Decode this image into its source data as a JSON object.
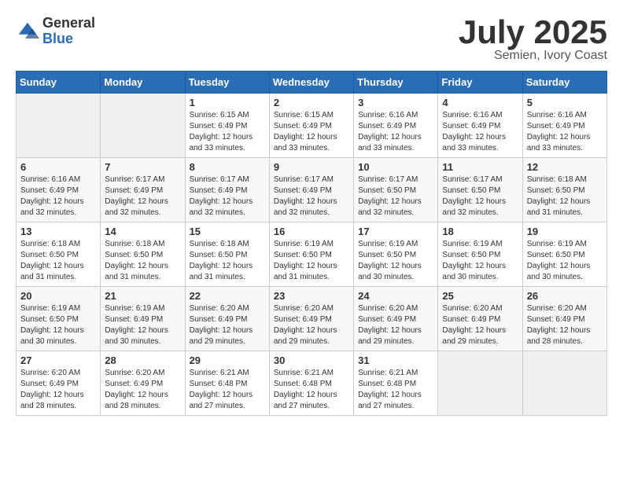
{
  "logo": {
    "general": "General",
    "blue": "Blue"
  },
  "header": {
    "month": "July 2025",
    "location": "Semien, Ivory Coast"
  },
  "weekdays": [
    "Sunday",
    "Monday",
    "Tuesday",
    "Wednesday",
    "Thursday",
    "Friday",
    "Saturday"
  ],
  "weeks": [
    [
      {
        "day": "",
        "sunrise": "",
        "sunset": "",
        "daylight": ""
      },
      {
        "day": "",
        "sunrise": "",
        "sunset": "",
        "daylight": ""
      },
      {
        "day": "1",
        "sunrise": "Sunrise: 6:15 AM",
        "sunset": "Sunset: 6:49 PM",
        "daylight": "Daylight: 12 hours and 33 minutes."
      },
      {
        "day": "2",
        "sunrise": "Sunrise: 6:15 AM",
        "sunset": "Sunset: 6:49 PM",
        "daylight": "Daylight: 12 hours and 33 minutes."
      },
      {
        "day": "3",
        "sunrise": "Sunrise: 6:16 AM",
        "sunset": "Sunset: 6:49 PM",
        "daylight": "Daylight: 12 hours and 33 minutes."
      },
      {
        "day": "4",
        "sunrise": "Sunrise: 6:16 AM",
        "sunset": "Sunset: 6:49 PM",
        "daylight": "Daylight: 12 hours and 33 minutes."
      },
      {
        "day": "5",
        "sunrise": "Sunrise: 6:16 AM",
        "sunset": "Sunset: 6:49 PM",
        "daylight": "Daylight: 12 hours and 33 minutes."
      }
    ],
    [
      {
        "day": "6",
        "sunrise": "Sunrise: 6:16 AM",
        "sunset": "Sunset: 6:49 PM",
        "daylight": "Daylight: 12 hours and 32 minutes."
      },
      {
        "day": "7",
        "sunrise": "Sunrise: 6:17 AM",
        "sunset": "Sunset: 6:49 PM",
        "daylight": "Daylight: 12 hours and 32 minutes."
      },
      {
        "day": "8",
        "sunrise": "Sunrise: 6:17 AM",
        "sunset": "Sunset: 6:49 PM",
        "daylight": "Daylight: 12 hours and 32 minutes."
      },
      {
        "day": "9",
        "sunrise": "Sunrise: 6:17 AM",
        "sunset": "Sunset: 6:49 PM",
        "daylight": "Daylight: 12 hours and 32 minutes."
      },
      {
        "day": "10",
        "sunrise": "Sunrise: 6:17 AM",
        "sunset": "Sunset: 6:50 PM",
        "daylight": "Daylight: 12 hours and 32 minutes."
      },
      {
        "day": "11",
        "sunrise": "Sunrise: 6:17 AM",
        "sunset": "Sunset: 6:50 PM",
        "daylight": "Daylight: 12 hours and 32 minutes."
      },
      {
        "day": "12",
        "sunrise": "Sunrise: 6:18 AM",
        "sunset": "Sunset: 6:50 PM",
        "daylight": "Daylight: 12 hours and 31 minutes."
      }
    ],
    [
      {
        "day": "13",
        "sunrise": "Sunrise: 6:18 AM",
        "sunset": "Sunset: 6:50 PM",
        "daylight": "Daylight: 12 hours and 31 minutes."
      },
      {
        "day": "14",
        "sunrise": "Sunrise: 6:18 AM",
        "sunset": "Sunset: 6:50 PM",
        "daylight": "Daylight: 12 hours and 31 minutes."
      },
      {
        "day": "15",
        "sunrise": "Sunrise: 6:18 AM",
        "sunset": "Sunset: 6:50 PM",
        "daylight": "Daylight: 12 hours and 31 minutes."
      },
      {
        "day": "16",
        "sunrise": "Sunrise: 6:19 AM",
        "sunset": "Sunset: 6:50 PM",
        "daylight": "Daylight: 12 hours and 31 minutes."
      },
      {
        "day": "17",
        "sunrise": "Sunrise: 6:19 AM",
        "sunset": "Sunset: 6:50 PM",
        "daylight": "Daylight: 12 hours and 30 minutes."
      },
      {
        "day": "18",
        "sunrise": "Sunrise: 6:19 AM",
        "sunset": "Sunset: 6:50 PM",
        "daylight": "Daylight: 12 hours and 30 minutes."
      },
      {
        "day": "19",
        "sunrise": "Sunrise: 6:19 AM",
        "sunset": "Sunset: 6:50 PM",
        "daylight": "Daylight: 12 hours and 30 minutes."
      }
    ],
    [
      {
        "day": "20",
        "sunrise": "Sunrise: 6:19 AM",
        "sunset": "Sunset: 6:50 PM",
        "daylight": "Daylight: 12 hours and 30 minutes."
      },
      {
        "day": "21",
        "sunrise": "Sunrise: 6:19 AM",
        "sunset": "Sunset: 6:49 PM",
        "daylight": "Daylight: 12 hours and 30 minutes."
      },
      {
        "day": "22",
        "sunrise": "Sunrise: 6:20 AM",
        "sunset": "Sunset: 6:49 PM",
        "daylight": "Daylight: 12 hours and 29 minutes."
      },
      {
        "day": "23",
        "sunrise": "Sunrise: 6:20 AM",
        "sunset": "Sunset: 6:49 PM",
        "daylight": "Daylight: 12 hours and 29 minutes."
      },
      {
        "day": "24",
        "sunrise": "Sunrise: 6:20 AM",
        "sunset": "Sunset: 6:49 PM",
        "daylight": "Daylight: 12 hours and 29 minutes."
      },
      {
        "day": "25",
        "sunrise": "Sunrise: 6:20 AM",
        "sunset": "Sunset: 6:49 PM",
        "daylight": "Daylight: 12 hours and 29 minutes."
      },
      {
        "day": "26",
        "sunrise": "Sunrise: 6:20 AM",
        "sunset": "Sunset: 6:49 PM",
        "daylight": "Daylight: 12 hours and 28 minutes."
      }
    ],
    [
      {
        "day": "27",
        "sunrise": "Sunrise: 6:20 AM",
        "sunset": "Sunset: 6:49 PM",
        "daylight": "Daylight: 12 hours and 28 minutes."
      },
      {
        "day": "28",
        "sunrise": "Sunrise: 6:20 AM",
        "sunset": "Sunset: 6:49 PM",
        "daylight": "Daylight: 12 hours and 28 minutes."
      },
      {
        "day": "29",
        "sunrise": "Sunrise: 6:21 AM",
        "sunset": "Sunset: 6:48 PM",
        "daylight": "Daylight: 12 hours and 27 minutes."
      },
      {
        "day": "30",
        "sunrise": "Sunrise: 6:21 AM",
        "sunset": "Sunset: 6:48 PM",
        "daylight": "Daylight: 12 hours and 27 minutes."
      },
      {
        "day": "31",
        "sunrise": "Sunrise: 6:21 AM",
        "sunset": "Sunset: 6:48 PM",
        "daylight": "Daylight: 12 hours and 27 minutes."
      },
      {
        "day": "",
        "sunrise": "",
        "sunset": "",
        "daylight": ""
      },
      {
        "day": "",
        "sunrise": "",
        "sunset": "",
        "daylight": ""
      }
    ]
  ]
}
